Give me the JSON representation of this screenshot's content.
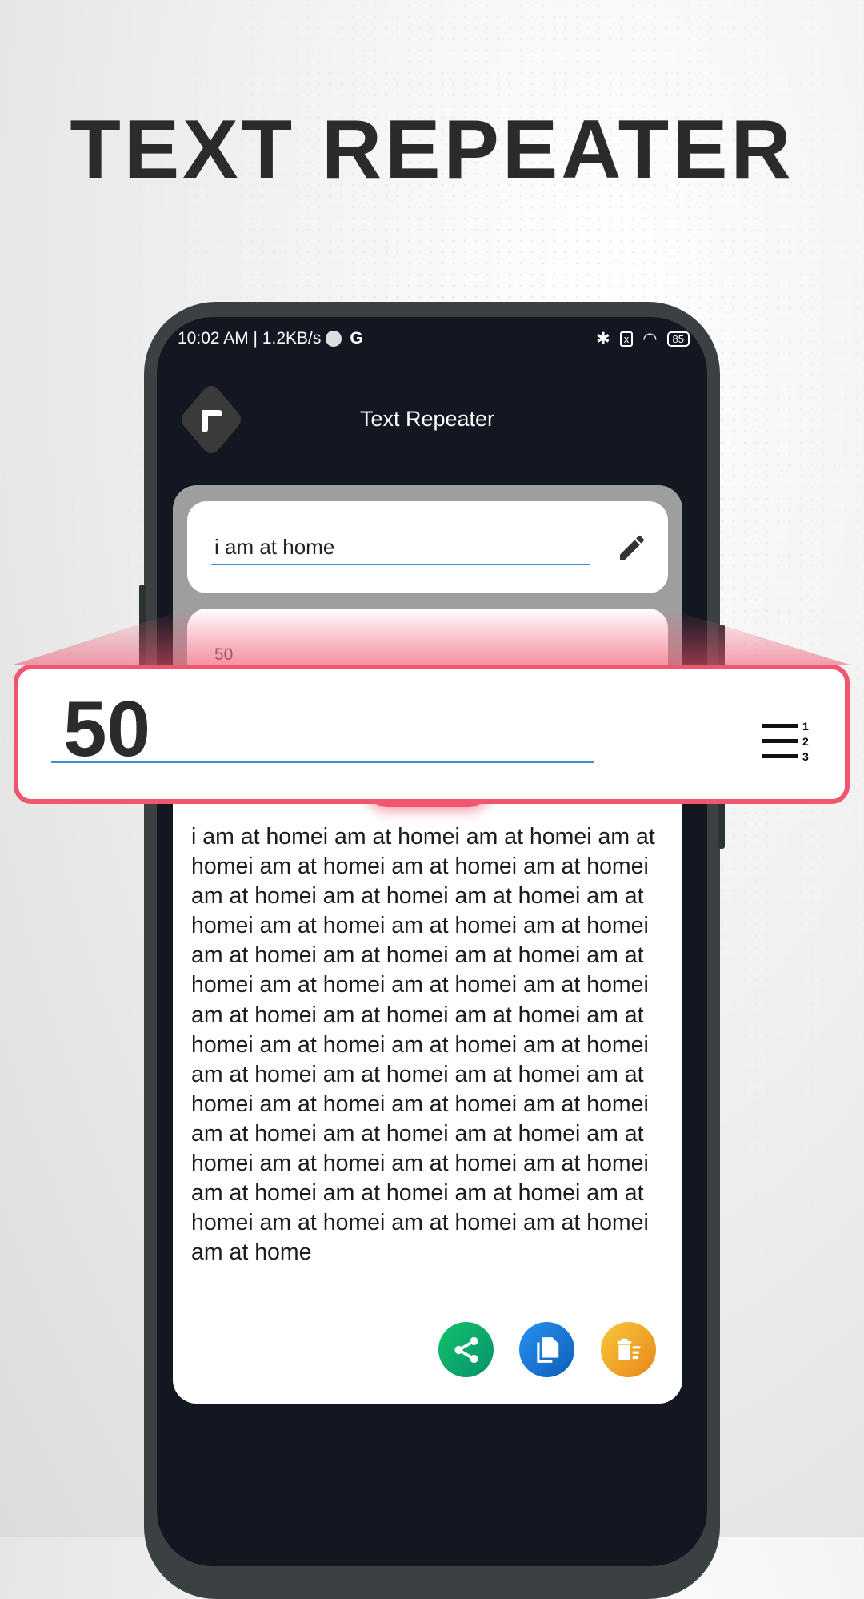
{
  "headline": "TEXT REPEATER",
  "status_bar": {
    "time_speed": "10:02 AM | 1.2KB/s",
    "carrier_icon": "G",
    "battery": "85"
  },
  "app": {
    "title": "Text Repeater",
    "back_icon": "back-arrow-icon"
  },
  "input": {
    "text": "i am at home",
    "icon": "pencil-icon"
  },
  "count": {
    "value": "50",
    "icon": "numbered-list-icon"
  },
  "output": {
    "text": "i am at homei am at homei am at homei am at homei am at homei am at homei am at homei am at homei am at homei am at homei am at homei am at homei am at homei am at homei am at homei am at homei am at homei am at homei am at homei am at homei am at homei am at homei am at homei am at homei am at homei am at homei am at homei am at homei am at homei am at homei am at homei am at homei am at homei am at homei am at homei am at homei am at homei am at homei am at homei am at homei am at homei am at homei am at homei am at homei am at homei am at homei am at homei am at homei am at homei am at home"
  },
  "actions": [
    {
      "name": "share",
      "color": "#0aa86a"
    },
    {
      "name": "copy",
      "color": "#1a7fe0"
    },
    {
      "name": "clear",
      "color": "#f0a520"
    }
  ],
  "colors": {
    "accent": "#f0566e",
    "underline": "#3c8ee0",
    "screen_bg": "#131722"
  }
}
